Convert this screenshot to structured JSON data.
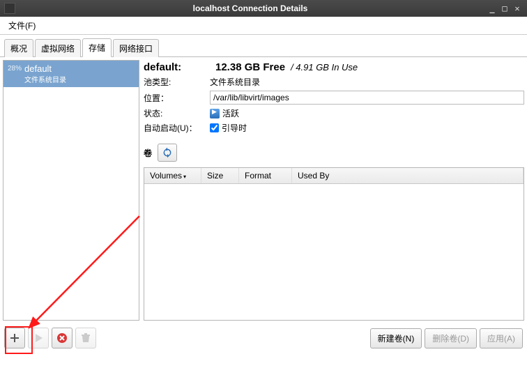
{
  "window": {
    "title": "localhost Connection Details"
  },
  "menu": {
    "file": "文件(F)"
  },
  "tabs": {
    "overview": "概况",
    "virtual_net": "虚拟网络",
    "storage": "存储",
    "net_interfaces": "网络接口"
  },
  "pool": {
    "percent": "28%",
    "name": "default",
    "type_sub": "文件系统目录"
  },
  "details": {
    "name_label": "default:",
    "free": "12.38 GB Free",
    "in_use": "/ 4.91 GB In Use",
    "pool_type_label": "池类型:",
    "pool_type_value": "文件系统目录",
    "location_label": "位置：",
    "location_value": "/var/lib/libvirt/images",
    "state_label": "状态:",
    "state_value": "活跃",
    "autostart_label": "自动启动(U)：",
    "autostart_value": "引导时",
    "volumes_label": "卷"
  },
  "columns": {
    "volumes": "Volumes",
    "size": "Size",
    "format": "Format",
    "used_by": "Used By"
  },
  "buttons": {
    "new_volume": "新建卷(N)",
    "delete_volume": "删除卷(D)",
    "apply": "应用(A)"
  }
}
